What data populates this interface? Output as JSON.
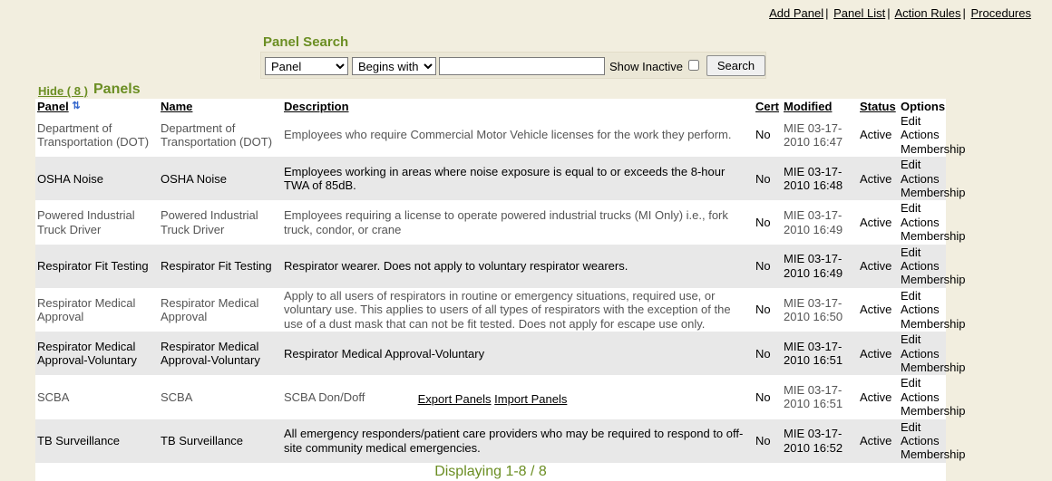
{
  "topnav": {
    "add_panel": "Add Panel",
    "panel_list": "Panel List",
    "action_rules": "Action Rules",
    "procedures": "Procedures"
  },
  "search": {
    "title": "Panel Search",
    "field_selected": "Panel",
    "operator_selected": "Begins with",
    "value": "",
    "show_inactive_label": "Show Inactive",
    "button_label": "Search"
  },
  "panels_header": {
    "hide_link": "Hide ( 8 )",
    "title": "Panels"
  },
  "table": {
    "columns": {
      "panel": "Panel",
      "name": "Name",
      "description": "Description",
      "cert": "Cert",
      "modified": "Modified",
      "status": "Status",
      "options": "Options"
    },
    "rows": [
      {
        "panel": "Department of Transportation (DOT)",
        "name": "Department of Transportation (DOT)",
        "description": "Employees who require Commercial Motor Vehicle licenses for the work they perform.",
        "cert": "No",
        "modified": "MIE 03-17-2010 16:47",
        "status": "Active",
        "edit": "Edit",
        "actions": "Actions",
        "membership": "Membership"
      },
      {
        "panel": "OSHA Noise",
        "name": "OSHA Noise",
        "description": "Employees working in areas where noise exposure is equal to or exceeds the 8-hour TWA of 85dB.",
        "cert": "No",
        "modified": "MIE 03-17-2010 16:48",
        "status": "Active",
        "edit": "Edit",
        "actions": "Actions",
        "membership": "Membership"
      },
      {
        "panel": "Powered Industrial Truck Driver",
        "name": "Powered Industrial Truck Driver",
        "description": "Employees requiring a license to operate powered industrial trucks (MI Only) i.e., fork truck, condor, or crane",
        "cert": "No",
        "modified": "MIE 03-17-2010 16:49",
        "status": "Active",
        "edit": "Edit",
        "actions": "Actions",
        "membership": "Membership"
      },
      {
        "panel": "Respirator Fit Testing",
        "name": "Respirator Fit Testing",
        "description": "Respirator wearer. Does not apply to voluntary respirator wearers.",
        "cert": "No",
        "modified": "MIE 03-17-2010 16:49",
        "status": "Active",
        "edit": "Edit",
        "actions": "Actions",
        "membership": "Membership"
      },
      {
        "panel": "Respirator Medical Approval",
        "name": "Respirator Medical Approval",
        "description": "Apply to all users of respirators in routine or emergency situations, required use, or voluntary use. This applies to users of all types of respirators with the exception of the use of a dust mask that can not be fit tested. Does not apply for escape use only.",
        "cert": "No",
        "modified": "MIE 03-17-2010 16:50",
        "status": "Active",
        "edit": "Edit",
        "actions": "Actions",
        "membership": "Membership"
      },
      {
        "panel": "Respirator Medical Approval-Voluntary",
        "name": "Respirator Medical Approval-Voluntary",
        "description": "Respirator Medical Approval-Voluntary",
        "cert": "No",
        "modified": "MIE 03-17-2010 16:51",
        "status": "Active",
        "edit": "Edit",
        "actions": "Actions",
        "membership": "Membership"
      },
      {
        "panel": "SCBA",
        "name": "SCBA",
        "description": "SCBA Don/Doff",
        "cert": "No",
        "modified": "MIE 03-17-2010 16:51",
        "status": "Active",
        "edit": "Edit",
        "actions": "Actions",
        "membership": "Membership"
      },
      {
        "panel": "TB Surveillance",
        "name": "TB Surveillance",
        "description": "All emergency responders/patient care providers who may be required to respond to off-site community medical emergencies.",
        "cert": "No",
        "modified": "MIE 03-17-2010 16:52",
        "status": "Active",
        "edit": "Edit",
        "actions": "Actions",
        "membership": "Membership"
      }
    ],
    "footer": "Displaying 1-8 / 8"
  },
  "bottom": {
    "export": "Export Panels",
    "import": "Import Panels"
  }
}
